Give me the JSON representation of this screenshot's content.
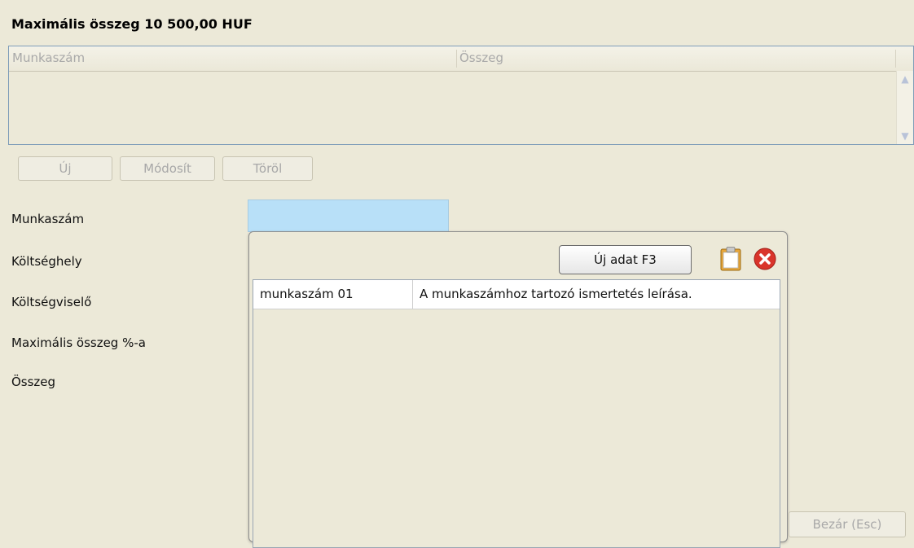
{
  "header": {
    "title": "Maximális összeg 10 500,00 HUF"
  },
  "grid": {
    "columns": [
      "Munkaszám",
      "Összeg"
    ],
    "rows": []
  },
  "grid_buttons": {
    "new": "Új",
    "modify": "Módosít",
    "delete": "Töröl"
  },
  "form": {
    "labels": [
      "Munkaszám",
      "Költséghely",
      "Költségviselő",
      "Maximális összeg %-a",
      "Összeg"
    ],
    "munkaszam_value": ""
  },
  "popup": {
    "new_button": "Új adat F3",
    "icons": {
      "clipboard": "clipboard-icon",
      "close": "close-icon"
    },
    "rows": [
      {
        "code": "munkaszám 01",
        "description": "A munkaszámhoz tartozó ismertetés leírása."
      }
    ]
  },
  "footer": {
    "close_button": "Bezár (Esc)"
  },
  "colors": {
    "background": "#ece9d8",
    "input_highlight": "#b8e0f8",
    "close_red": "#d9342b"
  }
}
